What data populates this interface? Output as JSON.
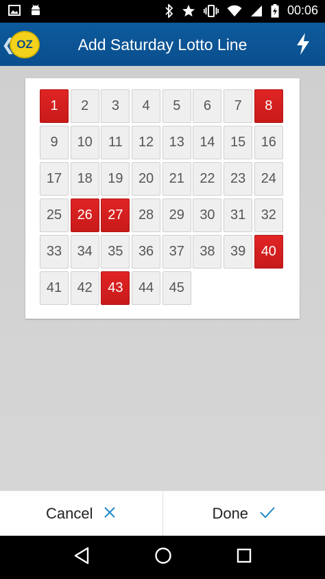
{
  "status_bar": {
    "time": "00:06",
    "left_icons": [
      "image-icon",
      "android-icon"
    ],
    "right_icons": [
      "bluetooth-icon",
      "star-icon",
      "vibrate-icon",
      "wifi-icon",
      "signal-icon",
      "battery-charging-icon"
    ]
  },
  "app_bar": {
    "title": "Add Saturday Lotto Line",
    "logo_text": "OZ",
    "back_glyph": "❮",
    "action_icon": "lightning-bolt-icon",
    "colors": {
      "background": "#0b54939",
      "logo": "#f4d21c"
    }
  },
  "number_grid": {
    "numbers": [
      "1",
      "2",
      "3",
      "4",
      "5",
      "6",
      "7",
      "8",
      "9",
      "10",
      "11",
      "12",
      "13",
      "14",
      "15",
      "16",
      "17",
      "18",
      "19",
      "20",
      "21",
      "22",
      "23",
      "24",
      "25",
      "26",
      "27",
      "28",
      "29",
      "30",
      "31",
      "32",
      "33",
      "34",
      "35",
      "36",
      "37",
      "38",
      "39",
      "40",
      "41",
      "42",
      "43",
      "44",
      "45"
    ],
    "selected": [
      "1",
      "8",
      "26",
      "27",
      "40",
      "43"
    ],
    "selected_color": "#d21e1e"
  },
  "actions": {
    "cancel_label": "Cancel",
    "done_label": "Done",
    "accent_color": "#1e88c8"
  },
  "nav_bar": {
    "icons": [
      "back-triangle-icon",
      "home-circle-icon",
      "recents-square-icon"
    ]
  }
}
